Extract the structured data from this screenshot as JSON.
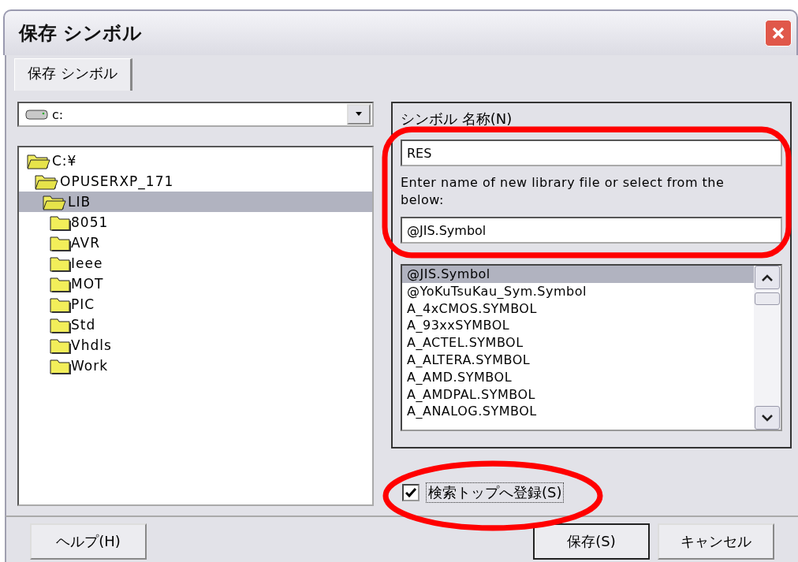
{
  "window": {
    "title": "保存 シンボル"
  },
  "tabs": [
    {
      "label": "保存 シンボル",
      "selected": true
    }
  ],
  "drive": {
    "value": "c:"
  },
  "tree": [
    {
      "label": "C:¥",
      "expanded": true,
      "selected": false,
      "children": [
        {
          "label": "OPUSERXP_171",
          "expanded": true,
          "selected": false,
          "children": [
            {
              "label": "LIB",
              "expanded": true,
              "selected": true,
              "children": [
                {
                  "label": "8051",
                  "expanded": false,
                  "selected": false
                },
                {
                  "label": "AVR",
                  "expanded": false,
                  "selected": false
                },
                {
                  "label": "Ieee",
                  "expanded": false,
                  "selected": false
                },
                {
                  "label": "MOT",
                  "expanded": false,
                  "selected": false
                },
                {
                  "label": "PIC",
                  "expanded": false,
                  "selected": false
                },
                {
                  "label": "Std",
                  "expanded": false,
                  "selected": false
                },
                {
                  "label": "Vhdls",
                  "expanded": false,
                  "selected": false
                },
                {
                  "label": "Work",
                  "expanded": false,
                  "selected": false
                }
              ]
            }
          ]
        }
      ]
    }
  ],
  "symbol_name": {
    "label": "シンボル 名称(N)",
    "value": "RES"
  },
  "library": {
    "hint": "Enter name of new library file or select from the below:",
    "value": "@JIS.Symbol",
    "items": [
      {
        "label": "@JIS.Symbol",
        "selected": true
      },
      {
        "label": "@YoKuTsuKau_Sym.Symbol",
        "selected": false
      },
      {
        "label": "A_4xCMOS.SYMBOL",
        "selected": false
      },
      {
        "label": "A_93xxSYMBOL",
        "selected": false
      },
      {
        "label": "A_ACTEL.SYMBOL",
        "selected": false
      },
      {
        "label": "A_ALTERA.SYMBOL",
        "selected": false
      },
      {
        "label": "A_AMD.SYMBOL",
        "selected": false
      },
      {
        "label": "A_AMDPAL.SYMBOL",
        "selected": false
      },
      {
        "label": "A_ANALOG.SYMBOL",
        "selected": false
      }
    ]
  },
  "register_top": {
    "label": "検索トップへ登録(S)",
    "checked": true
  },
  "buttons": [
    {
      "label": "ヘルプ(H)",
      "kind": "help"
    },
    {
      "label": "保存(S)",
      "kind": "default"
    },
    {
      "label": "キャンセル",
      "kind": "cancel"
    }
  ]
}
